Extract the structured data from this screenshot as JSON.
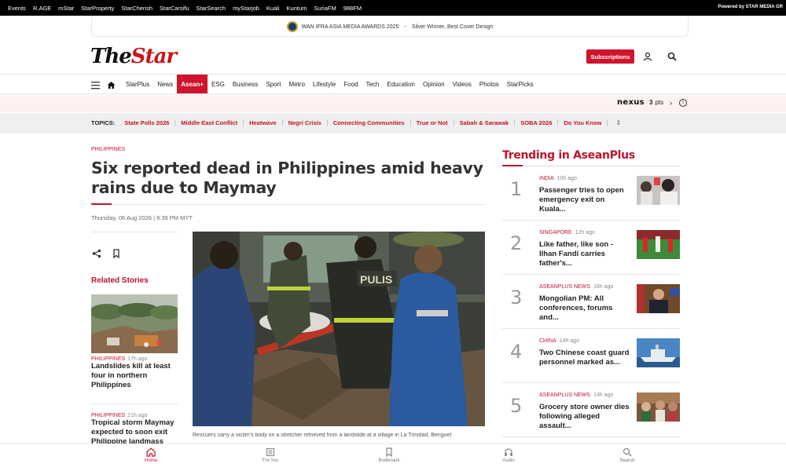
{
  "topbar": {
    "links": [
      "Events",
      "R.AGE",
      "mStar",
      "StarProperty",
      "StarCherish",
      "StarCarsifu",
      "StarSearch",
      "myStarjob",
      "Kuali",
      "Kuntum",
      "SuriaFM",
      "988FM"
    ],
    "powered": "Powered by STAR MEDIA GR"
  },
  "award": {
    "name": "WAN IFRA ASIA MEDIA AWARDS 2025",
    "result": "Silver Winner, Best Cover Design"
  },
  "header": {
    "logo_the": "The",
    "logo_star": "Star",
    "subscribe_label": "Subscriptions"
  },
  "nav": {
    "items": [
      {
        "label": "StarPlus"
      },
      {
        "label": "News"
      },
      {
        "label": "Asean+",
        "active": true
      },
      {
        "label": "ESG"
      },
      {
        "label": "Business"
      },
      {
        "label": "Sport"
      },
      {
        "label": "Metro"
      },
      {
        "label": "Lifestyle"
      },
      {
        "label": "Food"
      },
      {
        "label": "Tech"
      },
      {
        "label": "Education"
      },
      {
        "label": "Opinion"
      },
      {
        "label": "Videos"
      },
      {
        "label": "Photos"
      },
      {
        "label": "StarPicks"
      }
    ]
  },
  "nexus": {
    "brand": "nexus",
    "points": "3",
    "points_unit": "pts"
  },
  "topics": {
    "label": "TOPICS:",
    "items": [
      "State Polls 2026",
      "Middle East Conflict",
      "Heatwave",
      "Negri Crisis",
      "Connecting Communities",
      "True or Not",
      "Sabah & Sarawak",
      "SOBA 2026",
      "Do You Know"
    ]
  },
  "article": {
    "kicker": "PHILIPPINES",
    "headline": "Six reported dead in Philippines amid heavy rains due to Maymay",
    "dateline": "Thursday, 06 Aug 2026 | 9:39 PM MYT",
    "caption": "Rescuers carry a victim's body on a stretcher retrieved from a landslide at a village in La Trinidad, Benguet"
  },
  "related": {
    "title": "Related Stories",
    "items": [
      {
        "category": "PHILIPPINES",
        "time": "17h ago",
        "title": "Landslides kill at least four in northern Philippines"
      },
      {
        "category": "PHILIPPINES",
        "time": "21h ago",
        "title": "Tropical storm Maymay expected to soon exit Philippine landmass"
      }
    ]
  },
  "trending": {
    "title": "Trending in AseanPlus",
    "items": [
      {
        "num": "1",
        "category": "INDIA",
        "time": "10h ago",
        "title": "Passenger tries to open emergency exit on Kuala..."
      },
      {
        "num": "2",
        "category": "SINGAPORE",
        "time": "12h ago",
        "title": "Like father, like son - Ilhan Fandi carries father's..."
      },
      {
        "num": "3",
        "category": "ASEANPLUS NEWS",
        "time": "16h ago",
        "title": "Mongolian PM: All conferences, forums and..."
      },
      {
        "num": "4",
        "category": "CHINA",
        "time": "14h ago",
        "title": "Two Chinese coast guard personnel marked as..."
      },
      {
        "num": "5",
        "category": "ASEANPLUS NEWS",
        "time": "14h ago",
        "title": "Grocery store owner dies following alleged assault..."
      }
    ]
  },
  "bottom_nav": {
    "items": [
      {
        "label": "Home",
        "icon": "home-icon",
        "active": true
      },
      {
        "label": "For You",
        "icon": "newspaper-icon"
      },
      {
        "label": "Bookmark",
        "icon": "bookmark-icon"
      },
      {
        "label": "Audio",
        "icon": "headphones-icon"
      },
      {
        "label": "Search",
        "icon": "search-icon"
      }
    ]
  },
  "colors": {
    "brand_red": "#c0142c",
    "subscribe_red": "#d0142c",
    "topbar": "#000000"
  }
}
